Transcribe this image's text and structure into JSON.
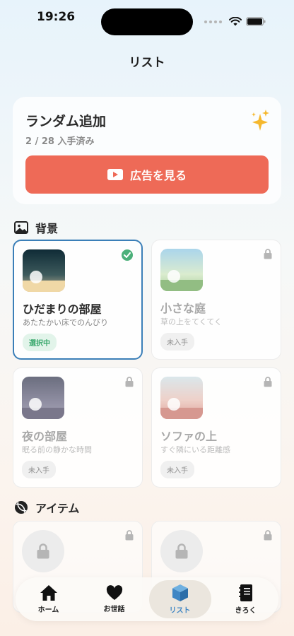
{
  "status_bar": {
    "time": "19:26"
  },
  "page_title": "リスト",
  "random": {
    "title": "ランダム追加",
    "progress": "2 / 28 入手済み",
    "ad_button": "広告を見る"
  },
  "sections": {
    "background": "背景",
    "items": "アイテム"
  },
  "backgrounds": [
    {
      "title": "ひだまりの部屋",
      "desc": "あたたかい床でのんびり",
      "badge": "選択中",
      "state": "selected"
    },
    {
      "title": "小さな庭",
      "desc": "草の上をてくてく",
      "badge": "未入手",
      "state": "locked"
    },
    {
      "title": "夜の部屋",
      "desc": "眠る前の静かな時間",
      "badge": "未入手",
      "state": "locked"
    },
    {
      "title": "ソファの上",
      "desc": "すぐ隣にいる距離感",
      "badge": "未入手",
      "state": "locked"
    }
  ],
  "tabs": [
    {
      "label": "ホーム",
      "icon": "home-icon"
    },
    {
      "label": "お世話",
      "icon": "heart-icon"
    },
    {
      "label": "リスト",
      "icon": "box-icon",
      "active": true
    },
    {
      "label": "きろく",
      "icon": "notebook-icon"
    }
  ],
  "colors": {
    "accent": "#ee6a57",
    "selected_border": "#3b7fb8",
    "active_tab": "#3f86c4",
    "badge_green": "#3aa86d"
  }
}
